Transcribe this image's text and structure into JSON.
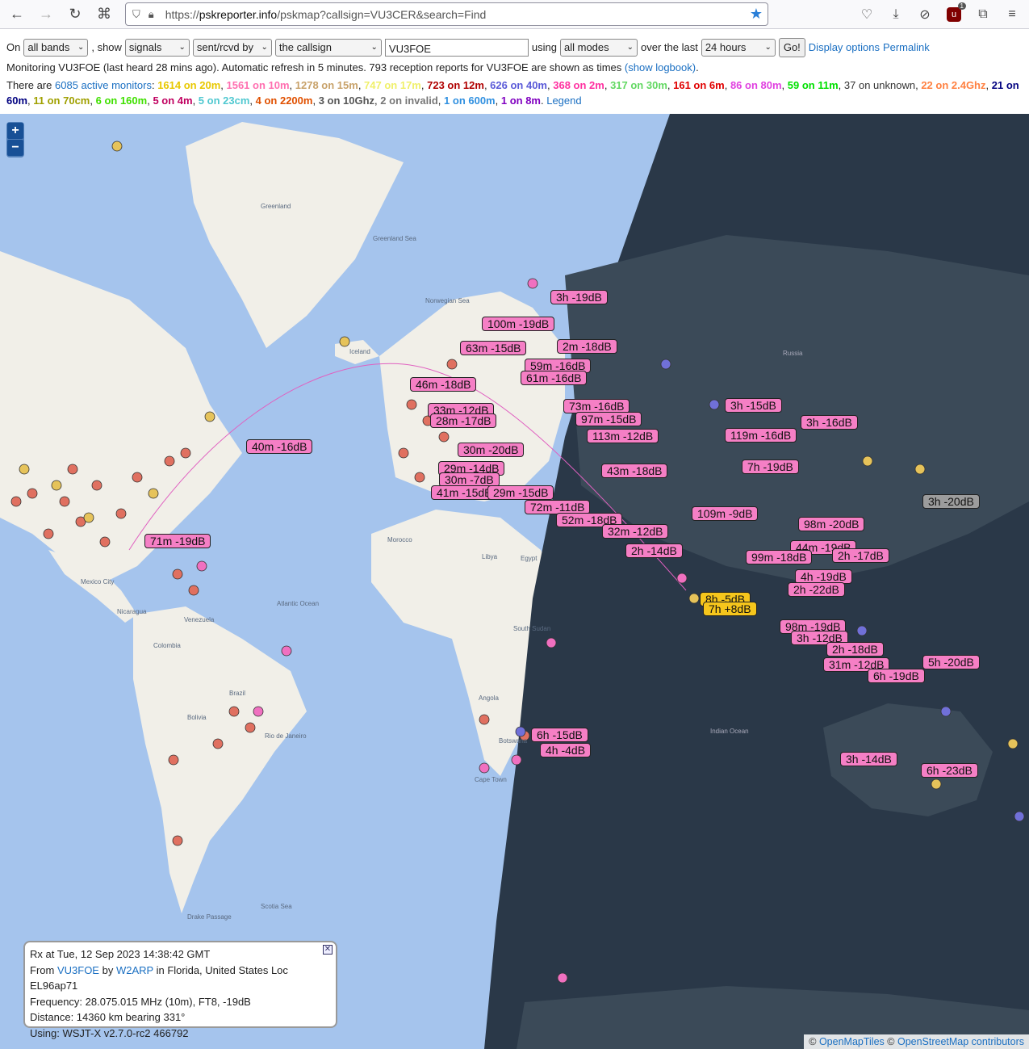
{
  "browser": {
    "url_prefix": "https://",
    "url_host": "pskreporter.info",
    "url_path": "/pskmap?callsign=VU3CER&search=Find",
    "ublock_count": "1"
  },
  "controls": {
    "on_label": "On",
    "band_select": "all bands",
    "show_label": ", show",
    "show_select": "signals",
    "direction_select": "sent/rcvd by",
    "target_select": "the callsign",
    "callsign_value": "VU3FOE",
    "using_label": "using",
    "mode_select": "all modes",
    "over_label": "over the last",
    "period_select": "24 hours",
    "go_button": "Go!",
    "display_options_link": "Display options",
    "permalink_link": "Permalink"
  },
  "status": {
    "monitoring_text": "Monitoring VU3FOE (last heard 28 mins ago). Automatic refresh in 5 minutes. 793 reception reports for VU3FOE are shown as times",
    "show_logbook_link": "(show logbook)",
    "trailing": ".",
    "there_are": "There are",
    "active_monitors": "6085 active monitors",
    "colon": ":",
    "legend_link": "Legend"
  },
  "bands": [
    {
      "text": "1614 on 20m",
      "color": "#e8c800"
    },
    {
      "text": "1561 on 10m",
      "color": "#ff6fb0"
    },
    {
      "text": "1278 on 15m",
      "color": "#c8a26a"
    },
    {
      "text": "747 on 17m",
      "color": "#f0f06a"
    },
    {
      "text": "723 on 12m",
      "color": "#b00000"
    },
    {
      "text": "626 on 40m",
      "color": "#5a5ad8"
    },
    {
      "text": "368 on 2m",
      "color": "#ff30a0"
    },
    {
      "text": "317 on 30m",
      "color": "#62d862"
    },
    {
      "text": "161 on 6m",
      "color": "#e00000"
    },
    {
      "text": "86 on 80m",
      "color": "#e040e0"
    },
    {
      "text": "59 on 11m",
      "color": "#00e000"
    },
    {
      "text": "37 on unknown",
      "color": "#333333"
    },
    {
      "text": "22 on 2.4Ghz",
      "color": "#ff8040"
    },
    {
      "text": "21 on 60m",
      "color": "#000080"
    },
    {
      "text": "11 on 70cm",
      "color": "#a0a000"
    },
    {
      "text": "6 on 160m",
      "color": "#40e000"
    },
    {
      "text": "5 on 4m",
      "color": "#c00060"
    },
    {
      "text": "5 on 23cm",
      "color": "#50c8d0"
    },
    {
      "text": "4 on 2200m",
      "color": "#e05000"
    },
    {
      "text": "3 on 10Ghz",
      "color": "#555555"
    },
    {
      "text": "2 on invalid",
      "color": "#777777"
    },
    {
      "text": "1 on 600m",
      "color": "#3090e0"
    },
    {
      "text": "1 on 8m",
      "color": "#8000c0"
    }
  ],
  "map": {
    "zoom_in": "+",
    "zoom_out": "−",
    "geo_labels": [
      "Greenland",
      "Greenland Sea",
      "Norwegian Sea",
      "Iceland",
      "Morocco",
      "Libya",
      "Egypt",
      "Atlantic Ocean",
      "South Sudan",
      "Angola",
      "Botswana",
      "Cape Town",
      "Colombia",
      "Venezuela",
      "Brazil",
      "Bolivia",
      "Rio de Janeiro",
      "Scotia Sea",
      "Drake Passage",
      "Mexico City",
      "Nicaragua",
      "Russia",
      "Indian Ocean"
    ],
    "report_labels": [
      {
        "text": "3h -19dB",
        "style": "pink"
      },
      {
        "text": "100m -19dB",
        "style": "pink"
      },
      {
        "text": "2m -18dB",
        "style": "pink"
      },
      {
        "text": "63m -15dB",
        "style": "pink"
      },
      {
        "text": "59m -16dB",
        "style": "pink"
      },
      {
        "text": "61m -16dB",
        "style": "pink"
      },
      {
        "text": "46m -18dB",
        "style": "pink"
      },
      {
        "text": "73m -16dB",
        "style": "pink"
      },
      {
        "text": "3h -15dB",
        "style": "pink"
      },
      {
        "text": "33m -12dB",
        "style": "pink"
      },
      {
        "text": "97m -15dB",
        "style": "pink"
      },
      {
        "text": "28m -17dB",
        "style": "pink"
      },
      {
        "text": "3h -16dB",
        "style": "pink"
      },
      {
        "text": "113m -12dB",
        "style": "pink"
      },
      {
        "text": "119m -16dB",
        "style": "pink"
      },
      {
        "text": "40m -16dB",
        "style": "pink"
      },
      {
        "text": "30m -20dB",
        "style": "pink"
      },
      {
        "text": "7h -19dB",
        "style": "pink"
      },
      {
        "text": "29m -14dB",
        "style": "pink"
      },
      {
        "text": "43m -18dB",
        "style": "pink"
      },
      {
        "text": "30m -7dB",
        "style": "pink"
      },
      {
        "text": "41m -15dB",
        "style": "pink"
      },
      {
        "text": "29m -15dB",
        "style": "pink"
      },
      {
        "text": "3h -20dB",
        "style": "gray"
      },
      {
        "text": "72m -11dB",
        "style": "pink"
      },
      {
        "text": "109m -9dB",
        "style": "pink"
      },
      {
        "text": "52m -18dB",
        "style": "pink"
      },
      {
        "text": "98m -20dB",
        "style": "pink"
      },
      {
        "text": "32m -12dB",
        "style": "pink"
      },
      {
        "text": "71m -19dB",
        "style": "pink"
      },
      {
        "text": "2h -14dB",
        "style": "pink"
      },
      {
        "text": "44m -19dB",
        "style": "pink"
      },
      {
        "text": "99m -18dB",
        "style": "pink"
      },
      {
        "text": "2h -17dB",
        "style": "pink"
      },
      {
        "text": "4h -19dB",
        "style": "pink"
      },
      {
        "text": "2h -22dB",
        "style": "pink"
      },
      {
        "text": "8h -5dB",
        "style": "gold"
      },
      {
        "text": "7h +8dB",
        "style": "gold"
      },
      {
        "text": "98m -19dB",
        "style": "pink"
      },
      {
        "text": "3h -12dB",
        "style": "pink"
      },
      {
        "text": "2h -18dB",
        "style": "pink"
      },
      {
        "text": "31m -12dB",
        "style": "pink"
      },
      {
        "text": "5h -20dB",
        "style": "pink"
      },
      {
        "text": "6h -19dB",
        "style": "pink"
      },
      {
        "text": "6h -15dB",
        "style": "pink"
      },
      {
        "text": "4h -4dB",
        "style": "pink"
      },
      {
        "text": "3h -14dB",
        "style": "pink"
      },
      {
        "text": "6h -23dB",
        "style": "pink"
      }
    ]
  },
  "popup": {
    "line1": "Rx at Tue, 12 Sep 2023 14:38:42 GMT",
    "from_label": "From",
    "from_call": "VU3FOE",
    "by_label": "by",
    "by_call": "W2ARP",
    "location": "in Florida, United States Loc EL96ap71",
    "line3": "Frequency: 28.075.015 MHz (10m), FT8, -19dB",
    "line4": "Distance: 14360 km bearing 331°",
    "line5": "Using: WSJT-X v2.7.0-rc2 466792",
    "close": "✕"
  },
  "attribution": {
    "copy1": "©",
    "openmaptiles": "OpenMapTiles",
    "copy2": "©",
    "osm": "OpenStreetMap contributors"
  },
  "colors": {
    "ocean": "#a5c4ed",
    "land": "#f1efe8",
    "night": "#2a3848",
    "label_pink": "#f57fc5",
    "label_gold": "#f6c61c",
    "link": "#1a6fc2"
  }
}
